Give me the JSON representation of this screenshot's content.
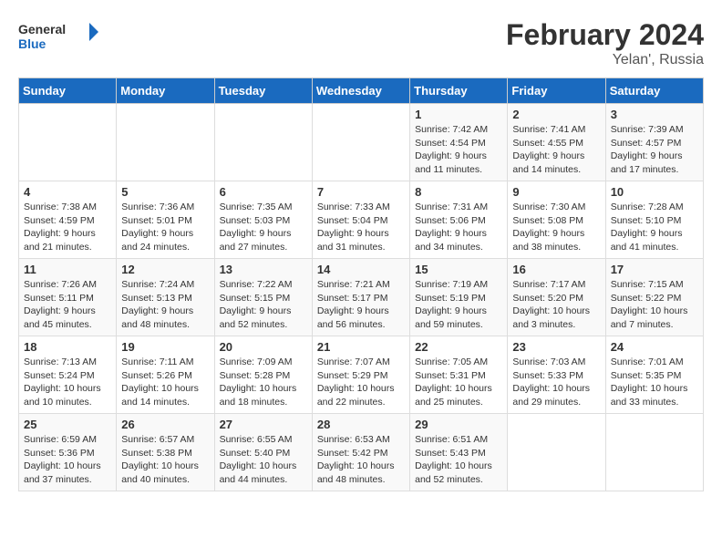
{
  "logo": {
    "text1": "General",
    "text2": "Blue"
  },
  "title": "February 2024",
  "subtitle": "Yelan', Russia",
  "days_of_week": [
    "Sunday",
    "Monday",
    "Tuesday",
    "Wednesday",
    "Thursday",
    "Friday",
    "Saturday"
  ],
  "weeks": [
    [
      {
        "day": "",
        "info": ""
      },
      {
        "day": "",
        "info": ""
      },
      {
        "day": "",
        "info": ""
      },
      {
        "day": "",
        "info": ""
      },
      {
        "day": "1",
        "info": "Sunrise: 7:42 AM\nSunset: 4:54 PM\nDaylight: 9 hours\nand 11 minutes."
      },
      {
        "day": "2",
        "info": "Sunrise: 7:41 AM\nSunset: 4:55 PM\nDaylight: 9 hours\nand 14 minutes."
      },
      {
        "day": "3",
        "info": "Sunrise: 7:39 AM\nSunset: 4:57 PM\nDaylight: 9 hours\nand 17 minutes."
      }
    ],
    [
      {
        "day": "4",
        "info": "Sunrise: 7:38 AM\nSunset: 4:59 PM\nDaylight: 9 hours\nand 21 minutes."
      },
      {
        "day": "5",
        "info": "Sunrise: 7:36 AM\nSunset: 5:01 PM\nDaylight: 9 hours\nand 24 minutes."
      },
      {
        "day": "6",
        "info": "Sunrise: 7:35 AM\nSunset: 5:03 PM\nDaylight: 9 hours\nand 27 minutes."
      },
      {
        "day": "7",
        "info": "Sunrise: 7:33 AM\nSunset: 5:04 PM\nDaylight: 9 hours\nand 31 minutes."
      },
      {
        "day": "8",
        "info": "Sunrise: 7:31 AM\nSunset: 5:06 PM\nDaylight: 9 hours\nand 34 minutes."
      },
      {
        "day": "9",
        "info": "Sunrise: 7:30 AM\nSunset: 5:08 PM\nDaylight: 9 hours\nand 38 minutes."
      },
      {
        "day": "10",
        "info": "Sunrise: 7:28 AM\nSunset: 5:10 PM\nDaylight: 9 hours\nand 41 minutes."
      }
    ],
    [
      {
        "day": "11",
        "info": "Sunrise: 7:26 AM\nSunset: 5:11 PM\nDaylight: 9 hours\nand 45 minutes."
      },
      {
        "day": "12",
        "info": "Sunrise: 7:24 AM\nSunset: 5:13 PM\nDaylight: 9 hours\nand 48 minutes."
      },
      {
        "day": "13",
        "info": "Sunrise: 7:22 AM\nSunset: 5:15 PM\nDaylight: 9 hours\nand 52 minutes."
      },
      {
        "day": "14",
        "info": "Sunrise: 7:21 AM\nSunset: 5:17 PM\nDaylight: 9 hours\nand 56 minutes."
      },
      {
        "day": "15",
        "info": "Sunrise: 7:19 AM\nSunset: 5:19 PM\nDaylight: 9 hours\nand 59 minutes."
      },
      {
        "day": "16",
        "info": "Sunrise: 7:17 AM\nSunset: 5:20 PM\nDaylight: 10 hours\nand 3 minutes."
      },
      {
        "day": "17",
        "info": "Sunrise: 7:15 AM\nSunset: 5:22 PM\nDaylight: 10 hours\nand 7 minutes."
      }
    ],
    [
      {
        "day": "18",
        "info": "Sunrise: 7:13 AM\nSunset: 5:24 PM\nDaylight: 10 hours\nand 10 minutes."
      },
      {
        "day": "19",
        "info": "Sunrise: 7:11 AM\nSunset: 5:26 PM\nDaylight: 10 hours\nand 14 minutes."
      },
      {
        "day": "20",
        "info": "Sunrise: 7:09 AM\nSunset: 5:28 PM\nDaylight: 10 hours\nand 18 minutes."
      },
      {
        "day": "21",
        "info": "Sunrise: 7:07 AM\nSunset: 5:29 PM\nDaylight: 10 hours\nand 22 minutes."
      },
      {
        "day": "22",
        "info": "Sunrise: 7:05 AM\nSunset: 5:31 PM\nDaylight: 10 hours\nand 25 minutes."
      },
      {
        "day": "23",
        "info": "Sunrise: 7:03 AM\nSunset: 5:33 PM\nDaylight: 10 hours\nand 29 minutes."
      },
      {
        "day": "24",
        "info": "Sunrise: 7:01 AM\nSunset: 5:35 PM\nDaylight: 10 hours\nand 33 minutes."
      }
    ],
    [
      {
        "day": "25",
        "info": "Sunrise: 6:59 AM\nSunset: 5:36 PM\nDaylight: 10 hours\nand 37 minutes."
      },
      {
        "day": "26",
        "info": "Sunrise: 6:57 AM\nSunset: 5:38 PM\nDaylight: 10 hours\nand 40 minutes."
      },
      {
        "day": "27",
        "info": "Sunrise: 6:55 AM\nSunset: 5:40 PM\nDaylight: 10 hours\nand 44 minutes."
      },
      {
        "day": "28",
        "info": "Sunrise: 6:53 AM\nSunset: 5:42 PM\nDaylight: 10 hours\nand 48 minutes."
      },
      {
        "day": "29",
        "info": "Sunrise: 6:51 AM\nSunset: 5:43 PM\nDaylight: 10 hours\nand 52 minutes."
      },
      {
        "day": "",
        "info": ""
      },
      {
        "day": "",
        "info": ""
      }
    ]
  ]
}
